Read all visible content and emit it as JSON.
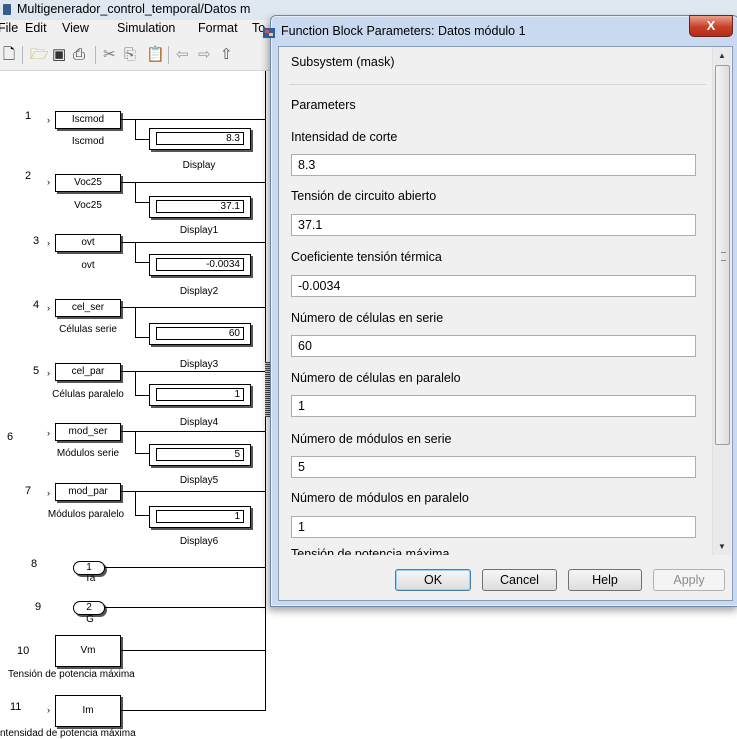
{
  "bg_window": {
    "title": "Multigenerador_control_temporal/Datos m",
    "menu": [
      "File",
      "Edit",
      "View",
      "Simulation",
      "Format",
      "To"
    ]
  },
  "model": {
    "inports": [
      {
        "num": "1",
        "name": "Iscmod",
        "label": "Iscmod",
        "display": "Display",
        "value": "8.3"
      },
      {
        "num": "2",
        "name": "Voc25",
        "label": "Voc25",
        "display": "Display1",
        "value": "37.1"
      },
      {
        "num": "3",
        "name": "ovt",
        "label": "ovt",
        "display": "Display2",
        "value": "-0.0034"
      },
      {
        "num": "4",
        "name": "cel_ser",
        "label": "Células serie",
        "display": "Display3",
        "value": "60"
      },
      {
        "num": "5",
        "name": "cel_par",
        "label": "Células paralelo",
        "display": "Display4",
        "value": "1"
      },
      {
        "num": "6",
        "name": "mod_ser",
        "label": "Módulos serie",
        "display": "Display5",
        "value": "5"
      },
      {
        "num": "7",
        "name": "mod_par",
        "label": "Módulos paralelo",
        "display": "Display6",
        "value": "1"
      }
    ],
    "constants": [
      {
        "num": "8",
        "value": "1",
        "label": "Ta"
      },
      {
        "num": "9",
        "value": "2",
        "label": "G"
      }
    ],
    "gotos": [
      {
        "num": "10",
        "name": "Vm",
        "label": "Tensión de potencia máxima"
      },
      {
        "num": "11",
        "name": "Im",
        "label": "ntensidad de potencia máxima"
      }
    ]
  },
  "dialog": {
    "title": "Function Block Parameters: Datos módulo 1",
    "close": "X",
    "section": "Subsystem (mask)",
    "group": "Parameters",
    "params": [
      {
        "label": "Intensidad de corte",
        "value": "8.3"
      },
      {
        "label": "Tensión de circuito abierto",
        "value": "37.1"
      },
      {
        "label": "Coeficiente tensión térmica",
        "value": "-0.0034"
      },
      {
        "label": "Número de células en serie",
        "value": "60"
      },
      {
        "label": "Número de células en paralelo",
        "value": "1"
      },
      {
        "label": "Número de módulos en serie",
        "value": "5"
      },
      {
        "label": "Número de módulos en paralelo",
        "value": "1"
      }
    ],
    "cut_label": "Tensión de potencia máxima",
    "buttons": {
      "ok": "OK",
      "cancel": "Cancel",
      "help": "Help",
      "apply": "Apply"
    }
  }
}
